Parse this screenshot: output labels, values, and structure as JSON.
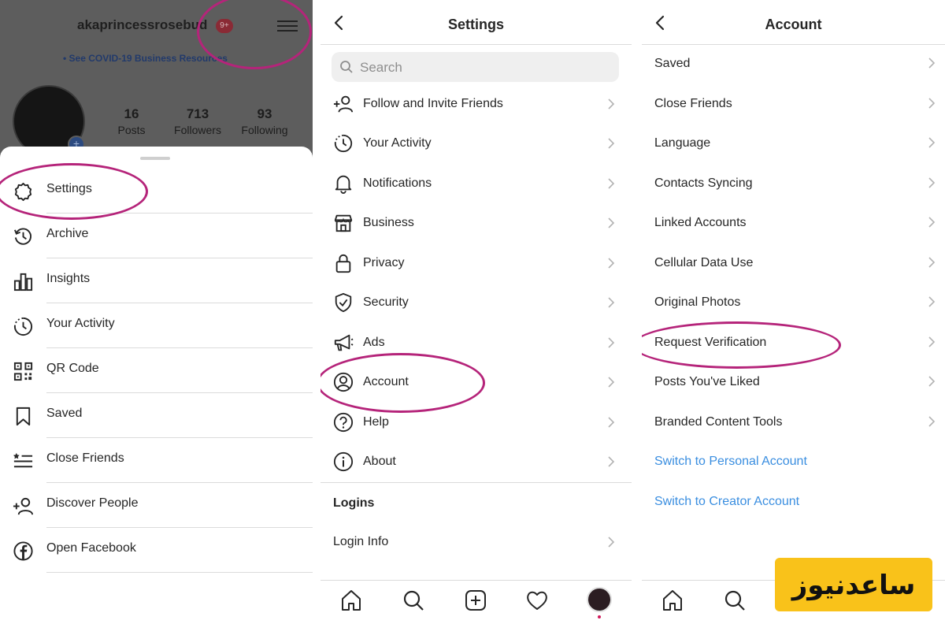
{
  "profile": {
    "username": "akaprincessrosebud",
    "badge_count": "9+",
    "covid_link": "• See COVID-19 Business Resources",
    "stats": [
      {
        "value": "16",
        "label": "Posts"
      },
      {
        "value": "713",
        "label": "Followers"
      },
      {
        "value": "93",
        "label": "Following"
      }
    ]
  },
  "menu": {
    "items": [
      {
        "label": "Settings",
        "icon": "settings-icon"
      },
      {
        "label": "Archive",
        "icon": "archive-icon"
      },
      {
        "label": "Insights",
        "icon": "insights-icon"
      },
      {
        "label": "Your Activity",
        "icon": "activity-icon"
      },
      {
        "label": "QR Code",
        "icon": "qr-code-icon"
      },
      {
        "label": "Saved",
        "icon": "bookmark-icon"
      },
      {
        "label": "Close Friends",
        "icon": "close-friends-icon"
      },
      {
        "label": "Discover People",
        "icon": "add-person-icon"
      },
      {
        "label": "Open Facebook",
        "icon": "facebook-icon"
      }
    ]
  },
  "settings": {
    "title": "Settings",
    "search_placeholder": "Search",
    "items": [
      {
        "label": "Follow and Invite Friends",
        "icon": "add-person-icon"
      },
      {
        "label": "Your Activity",
        "icon": "activity-icon"
      },
      {
        "label": "Notifications",
        "icon": "bell-icon"
      },
      {
        "label": "Business",
        "icon": "shop-icon"
      },
      {
        "label": "Privacy",
        "icon": "lock-icon"
      },
      {
        "label": "Security",
        "icon": "shield-icon"
      },
      {
        "label": "Ads",
        "icon": "megaphone-icon"
      },
      {
        "label": "Account",
        "icon": "account-icon"
      },
      {
        "label": "Help",
        "icon": "help-icon"
      },
      {
        "label": "About",
        "icon": "info-icon"
      }
    ],
    "logins_header": "Logins",
    "login_info": "Login Info"
  },
  "account": {
    "title": "Account",
    "items": [
      {
        "label": "Saved"
      },
      {
        "label": "Close Friends"
      },
      {
        "label": "Language"
      },
      {
        "label": "Contacts Syncing"
      },
      {
        "label": "Linked Accounts"
      },
      {
        "label": "Cellular Data Use"
      },
      {
        "label": "Original Photos"
      },
      {
        "label": "Request Verification"
      },
      {
        "label": "Posts You've Liked"
      },
      {
        "label": "Branded Content Tools"
      }
    ],
    "links": [
      {
        "label": "Switch to Personal Account"
      },
      {
        "label": "Switch to Creator Account"
      }
    ]
  },
  "colors": {
    "highlight": "#b5247a",
    "link": "#3a8ee0",
    "watermark": "#f9c21a"
  },
  "watermark": {
    "text": "ساعدنیوز"
  }
}
